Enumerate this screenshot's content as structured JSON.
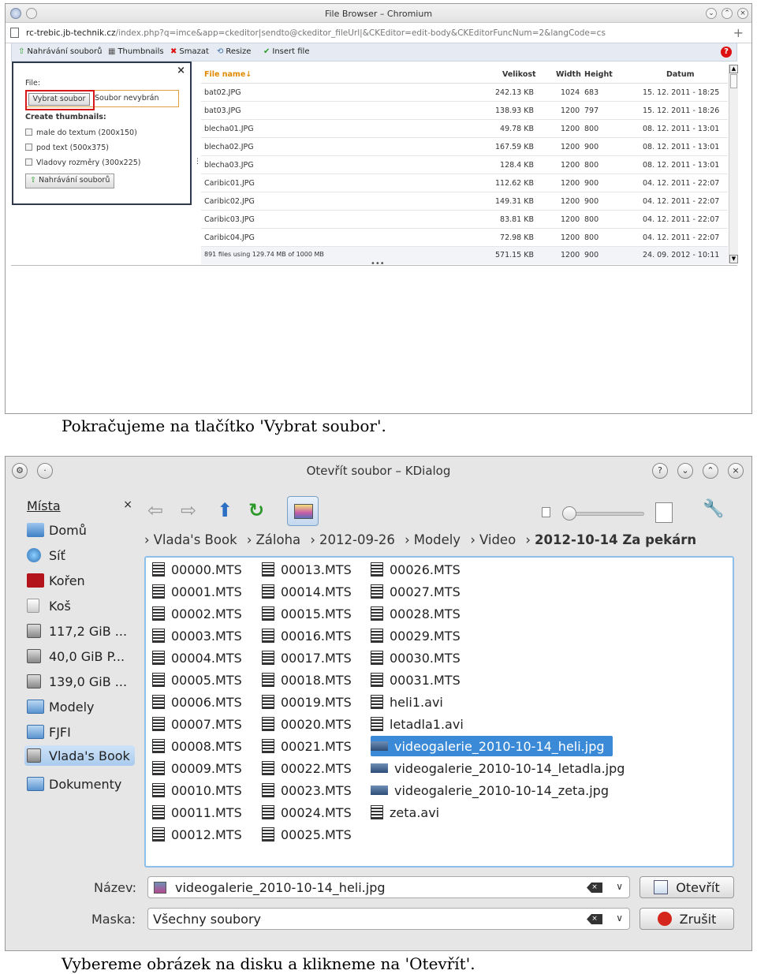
{
  "shot1": {
    "window_title": "File Browser – Chromium",
    "url_host": "rc-trebic.jb-technik.cz",
    "url_rest": "/index.php?q=imce&app=ckeditor|sendto@ckeditor_fileUrl|&CKEditor=edit-body&CKEditorFuncNum=2&langCode=cs",
    "toolbar": {
      "upload": "Nahrávání souborů",
      "thumbnails": "Thumbnails",
      "delete": "Smazat",
      "resize": "Resize",
      "insert": "Insert file"
    },
    "upload_panel": {
      "file_label": "File:",
      "choose_button": "Vybrat soubor",
      "no_file": "Soubor nevybrán",
      "create_thumbnails": "Create thumbnails:",
      "options": [
        "male do textum (200x150)",
        "pod text (500x375)",
        "Vladovy rozměry (300x225)"
      ],
      "submit": "Nahrávání souborů"
    },
    "table": {
      "headers": {
        "name": "File name↓",
        "size": "Velikost",
        "width": "Width",
        "height": "Height",
        "date": "Datum"
      },
      "rows": [
        {
          "name": "bat02.JPG",
          "size": "242.13 KB",
          "w": "1024",
          "h": "683",
          "date": "15. 12. 2011 - 18:25"
        },
        {
          "name": "bat03.JPG",
          "size": "138.93 KB",
          "w": "1200",
          "h": "797",
          "date": "15. 12. 2011 - 18:26"
        },
        {
          "name": "blecha01.JPG",
          "size": "49.78 KB",
          "w": "1200",
          "h": "800",
          "date": "08. 12. 2011 - 13:01"
        },
        {
          "name": "blecha02.JPG",
          "size": "167.59 KB",
          "w": "1200",
          "h": "900",
          "date": "08. 12. 2011 - 13:01"
        },
        {
          "name": "blecha03.JPG",
          "size": "128.4 KB",
          "w": "1200",
          "h": "800",
          "date": "08. 12. 2011 - 13:01"
        },
        {
          "name": "Caribic01.JPG",
          "size": "112.62 KB",
          "w": "1200",
          "h": "900",
          "date": "04. 12. 2011 - 22:07"
        },
        {
          "name": "Caribic02.JPG",
          "size": "149.31 KB",
          "w": "1200",
          "h": "900",
          "date": "04. 12. 2011 - 22:07"
        },
        {
          "name": "Caribic03.JPG",
          "size": "83.81 KB",
          "w": "1200",
          "h": "800",
          "date": "04. 12. 2011 - 22:07"
        },
        {
          "name": "Caribic04.JPG",
          "size": "72.98 KB",
          "w": "1200",
          "h": "800",
          "date": "04. 12. 2011 - 22:07"
        }
      ],
      "footer": {
        "summary": "891 files using 129.74 MB of 1000 MB",
        "size": "571.15 KB",
        "w": "1200",
        "h": "900",
        "date": "24. 09. 2012 - 10:11"
      }
    }
  },
  "caption1": "Pokračujeme na tlačítko 'Vybrat soubor'.",
  "shot2": {
    "window_title": "Otevřít soubor – KDialog",
    "places": {
      "header": "Místa",
      "items": [
        "Domů",
        "Síť",
        "Kořen",
        "Koš",
        "117,2 GiB ...",
        "40,0 GiB P...",
        "139,0 GiB ...",
        "Modely",
        "FJFI",
        "Vlada's Book",
        "Dokumenty"
      ]
    },
    "breadcrumb": [
      "Vlada's Book",
      "Záloha",
      "2012-09-26",
      "Modely",
      "Video"
    ],
    "breadcrumb_current": "2012-10-14 Za pekárn",
    "files_col1": [
      "00000.MTS",
      "00001.MTS",
      "00002.MTS",
      "00003.MTS",
      "00004.MTS",
      "00005.MTS",
      "00006.MTS",
      "00007.MTS",
      "00008.MTS",
      "00009.MTS",
      "00010.MTS",
      "00011.MTS",
      "00012.MTS"
    ],
    "files_col2": [
      "00013.MTS",
      "00014.MTS",
      "00015.MTS",
      "00016.MTS",
      "00017.MTS",
      "00018.MTS",
      "00019.MTS",
      "00020.MTS",
      "00021.MTS",
      "00022.MTS",
      "00023.MTS",
      "00024.MTS",
      "00025.MTS"
    ],
    "files_col3": [
      "00026.MTS",
      "00027.MTS",
      "00028.MTS",
      "00029.MTS",
      "00030.MTS",
      "00031.MTS",
      "heli1.avi",
      "letadla1.avi",
      "videogalerie_2010-10-14_heli.jpg",
      "videogalerie_2010-10-14_letadla.jpg",
      "videogalerie_2010-10-14_zeta.jpg",
      "zeta.avi"
    ],
    "name_label": "Název:",
    "name_value": "videogalerie_2010-10-14_heli.jpg",
    "mask_label": "Maska:",
    "mask_value": "Všechny soubory",
    "open_button": "Otevřít",
    "cancel_button": "Zrušit"
  },
  "caption2": "Vybereme obrázek na disku a klikneme na 'Otevřít'."
}
